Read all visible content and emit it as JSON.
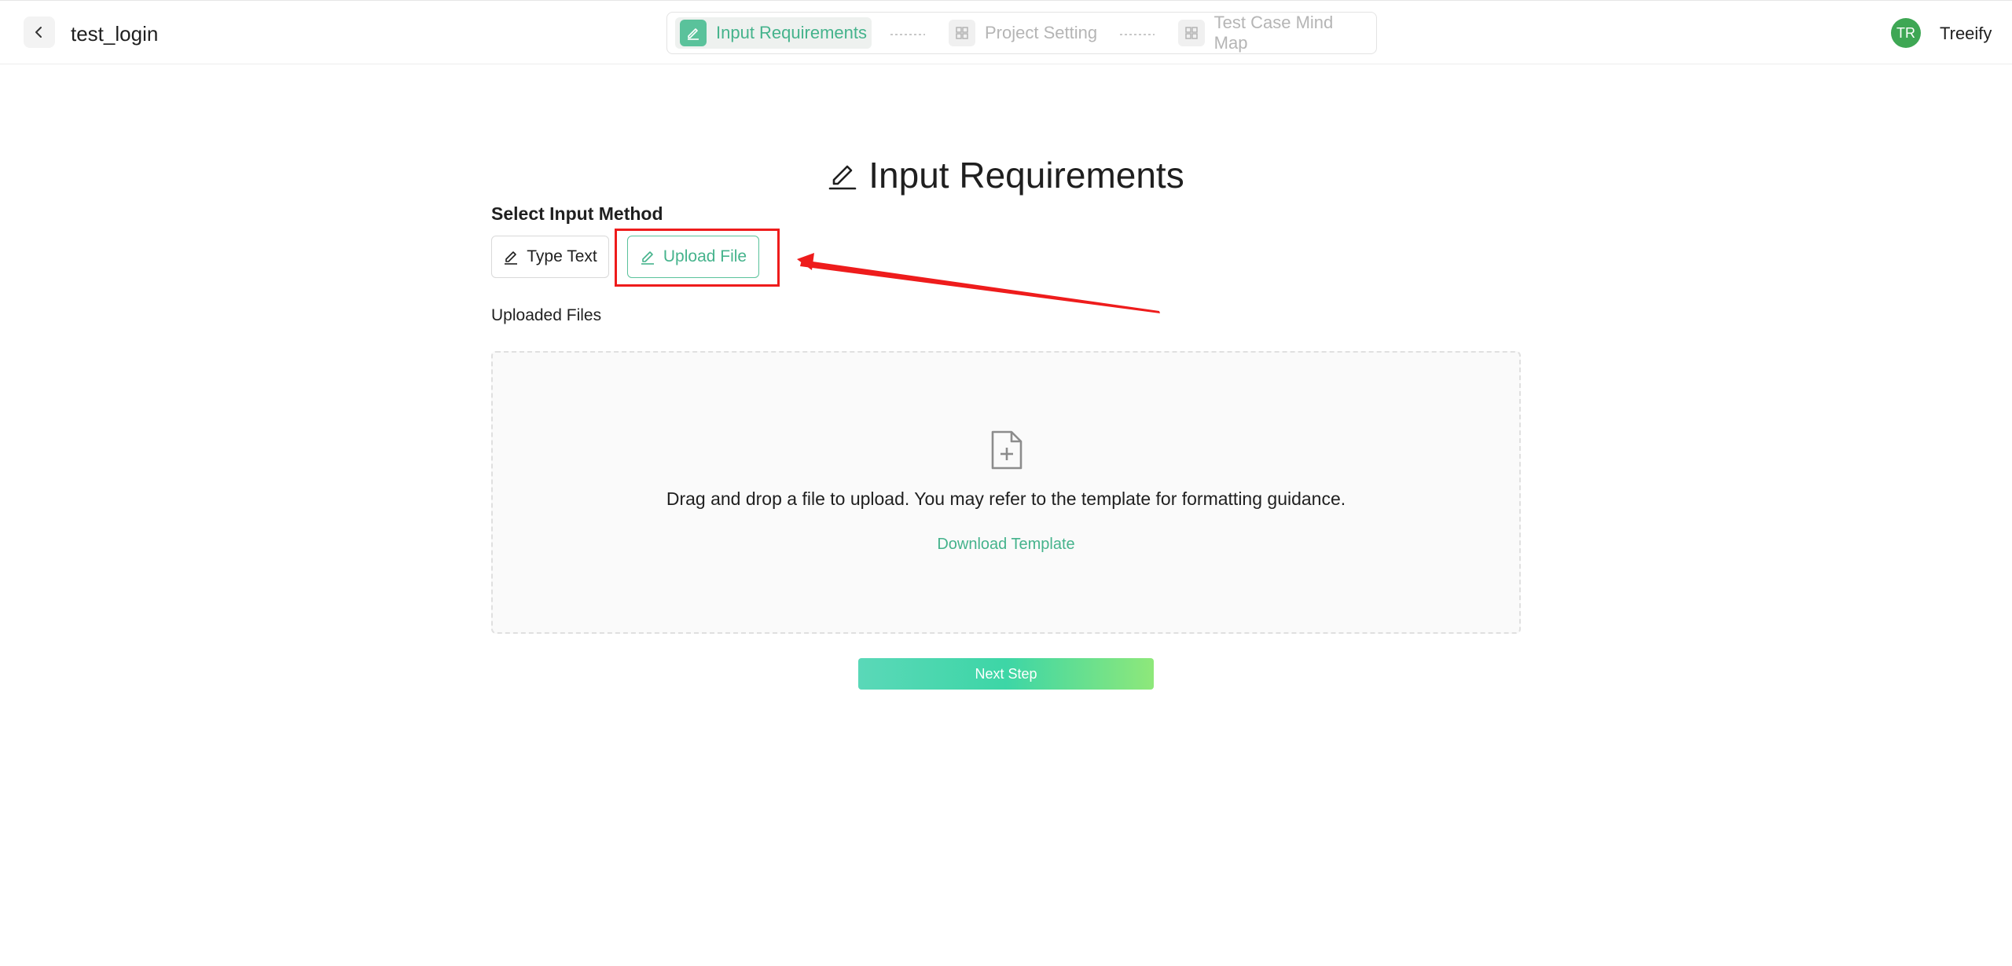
{
  "header": {
    "project_name": "test_login",
    "steps": [
      {
        "label": "Input Requirements",
        "state": "active"
      },
      {
        "label": "Project Setting",
        "state": "inactive"
      },
      {
        "label": "Test Case Mind Map",
        "state": "inactive"
      }
    ],
    "user": {
      "initials": "TR",
      "name": "Treeify"
    }
  },
  "main": {
    "title": "Input Requirements",
    "select_method_label": "Select Input Method",
    "methods": {
      "type_text": "Type Text",
      "upload_file": "Upload File",
      "selected": "upload_file"
    },
    "uploaded_files_label": "Uploaded Files",
    "dropzone": {
      "text": "Drag and drop a file to upload. You may refer to the template for formatting guidance.",
      "download_link": "Download Template"
    },
    "next_button": "Next Step"
  },
  "colors": {
    "accent": "#45b38c",
    "annotation": "#ee1c1c",
    "avatar": "#3ea754"
  },
  "icons": {
    "back": "chevron-left-icon",
    "step_active": "edit-pen-icon",
    "step_inactive": "grid-icon",
    "method": "edit-pen-icon",
    "dropzone": "file-plus-icon"
  }
}
